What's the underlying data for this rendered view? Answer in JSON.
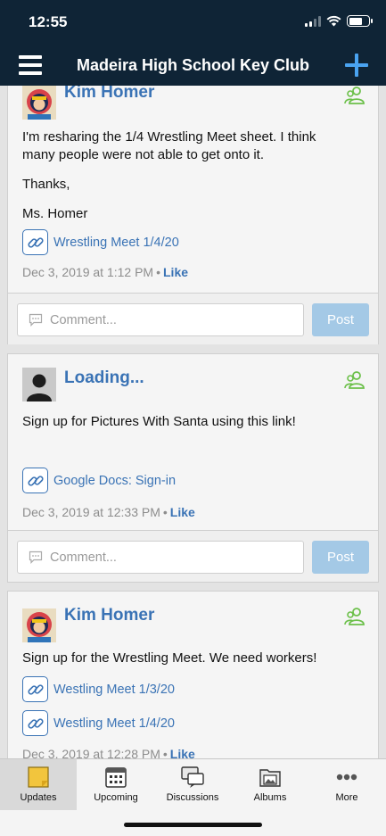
{
  "status_bar": {
    "time": "12:55"
  },
  "nav": {
    "title": "Madeira High School Key Club"
  },
  "posts": [
    {
      "author": "Kim Homer",
      "lines": [
        "I'm resharing the 1/4 Wrestling Meet sheet.  I think",
        "many people were not able to get onto it.",
        "Thanks,",
        "Ms. Homer"
      ],
      "attachments": [
        "Wrestling Meet 1/4/20"
      ],
      "timestamp": "Dec 3, 2019 at 1:12 PM",
      "like_label": "Like",
      "comment_placeholder": "Comment...",
      "post_label": "Post"
    },
    {
      "author": "Loading...",
      "lines": [
        "Sign up for Pictures With Santa using this link!"
      ],
      "attachments": [
        "Google Docs: Sign-in"
      ],
      "timestamp": "Dec 3, 2019 at 12:33 PM",
      "like_label": "Like",
      "comment_placeholder": "Comment...",
      "post_label": "Post"
    },
    {
      "author": "Kim Homer",
      "lines": [
        "Sign up for the Wrestling Meet.  We need workers!"
      ],
      "attachments": [
        "Westling Meet 1/3/20",
        "Westling Meet 1/4/20"
      ],
      "timestamp": "Dec 3, 2019 at 12:28 PM",
      "like_label": "Like"
    }
  ],
  "tabs": [
    {
      "label": "Updates",
      "icon": "updates-icon",
      "active": true
    },
    {
      "label": "Upcoming",
      "icon": "calendar-icon"
    },
    {
      "label": "Discussions",
      "icon": "discussions-icon"
    },
    {
      "label": "Albums",
      "icon": "albums-icon"
    },
    {
      "label": "More",
      "icon": "more-icon"
    }
  ],
  "colors": {
    "nav_bg": "#0f2436",
    "link_blue": "#3a73b5",
    "post_button": "#a4c9e6",
    "accent_plus": "#4aa3f0",
    "member_green": "#6cc04a"
  }
}
